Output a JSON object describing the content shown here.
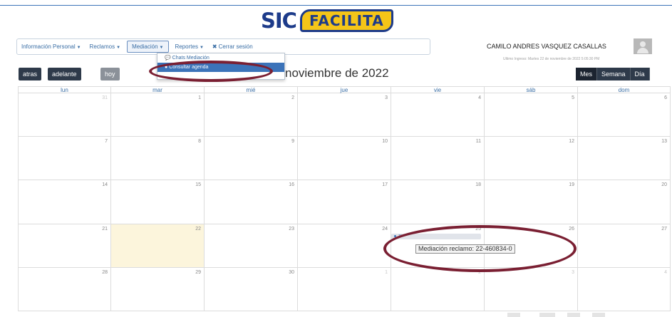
{
  "header": {
    "logo_sic": "SIC",
    "logo_facilita": "FACILITA"
  },
  "nav": {
    "items": [
      {
        "label": "Información Personal"
      },
      {
        "label": "Reclamos"
      },
      {
        "label": "Mediación"
      },
      {
        "label": "Reportes"
      },
      {
        "label": "Cerrar sesión"
      }
    ],
    "mediacion_menu": [
      {
        "label": "Chats Mediación"
      },
      {
        "label": "Consultar agenda"
      }
    ]
  },
  "user": {
    "name": "CAMILO ANDRES VASQUEZ CASALLAS",
    "last_login": "Ultimo Ingreso: Martes 22 de noviembre de 2022 5:05:30 PM"
  },
  "toolbar": {
    "prev_label": "atras",
    "next_label": "adelante",
    "today_label": "hoy",
    "month_title": "noviembre de 2022",
    "views": [
      "Mes",
      "Semana",
      "Día"
    ],
    "active_view": "Mes"
  },
  "calendar": {
    "weekdays": [
      "lun",
      "mar",
      "mié",
      "jue",
      "vie",
      "sáb",
      "dom"
    ],
    "weeks": [
      [
        "31",
        "1",
        "2",
        "3",
        "4",
        "5",
        "6"
      ],
      [
        "7",
        "8",
        "9",
        "10",
        "11",
        "12",
        "13"
      ],
      [
        "14",
        "15",
        "16",
        "17",
        "18",
        "19",
        "20"
      ],
      [
        "21",
        "22",
        "23",
        "24",
        "25",
        "26",
        "27"
      ],
      [
        "28",
        "29",
        "30",
        "1",
        "2",
        "3",
        "4"
      ]
    ],
    "today": "22",
    "event": {
      "time": "11",
      "tooltip": "Mediación reclamo: 22-460834-0"
    }
  },
  "colors": {
    "accent": "#3b73b9",
    "dark_button": "#2e3a4a",
    "highlight_circle": "#7a1f32",
    "today_bg": "#fcf5dc"
  }
}
